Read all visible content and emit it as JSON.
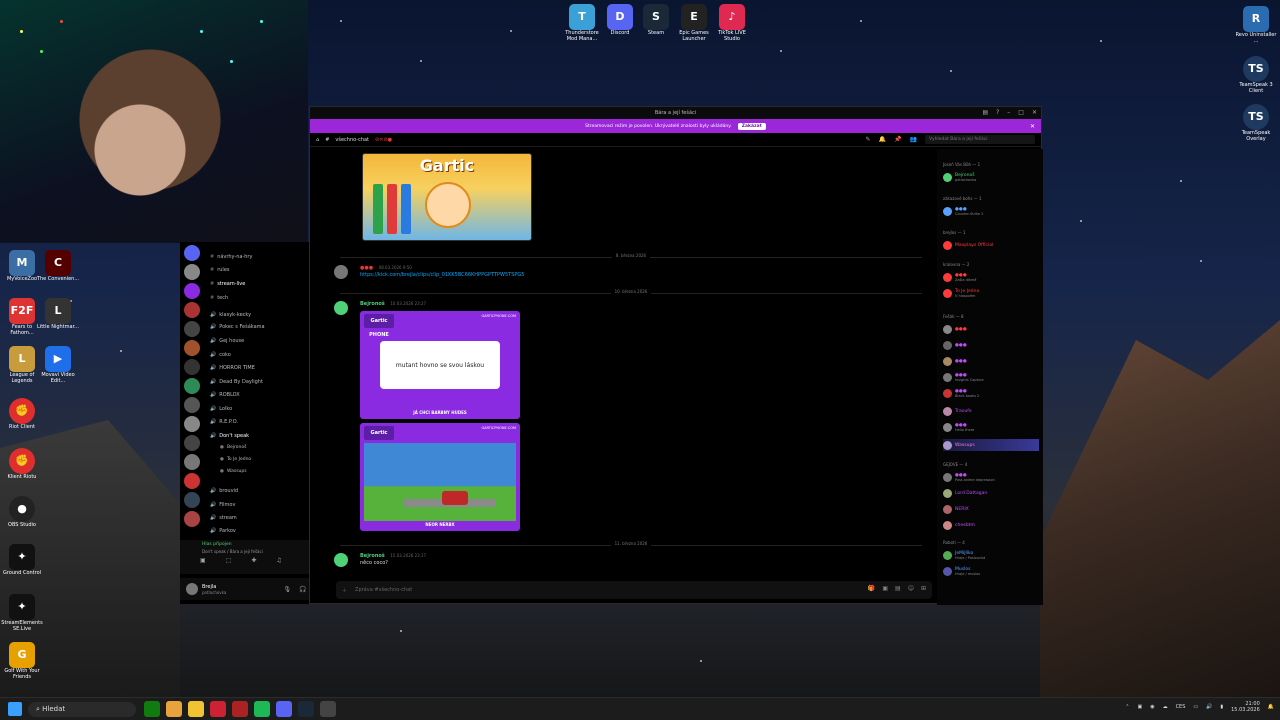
{
  "desktop": {
    "top_icons": [
      {
        "label": "Thunderstore Mod Mana...",
        "icon": "thunderstore-icon",
        "color": "#3aa0d6"
      },
      {
        "label": "Discord",
        "icon": "discord-icon",
        "color": "#5865f2"
      },
      {
        "label": "Steam",
        "icon": "steam-icon",
        "color": "#1b2838"
      },
      {
        "label": "Epic Games Launcher",
        "icon": "epic-icon",
        "color": "#222"
      },
      {
        "label": "TikTok LIVE Studio",
        "icon": "tiktok-icon",
        "color": "#e02950"
      }
    ],
    "right_icons": [
      {
        "label": "Revo Uninstaller ...",
        "icon": "revo-icon"
      },
      {
        "label": "TeamSpeak 3 Client",
        "icon": "teamspeak-icon"
      },
      {
        "label": "TeamSpeak Overlay",
        "icon": "teamspeak-overlay-icon"
      }
    ],
    "left_icons": [
      {
        "label": "MyVoiceZoo",
        "icon": "myvoicezoo-icon"
      },
      {
        "label": "The Convenien...",
        "icon": "convenience-icon"
      },
      {
        "label": "Fears to Fathom...",
        "icon": "f2f-icon"
      },
      {
        "label": "Little Nightmar...",
        "icon": "little-nightmares-icon"
      },
      {
        "label": "League of Legends",
        "icon": "lol-icon"
      },
      {
        "label": "Movavi Video Edit...",
        "icon": "movavi-icon"
      },
      {
        "label": "Riot Client",
        "icon": "riot-icon"
      },
      {
        "label": "Klient Riotu",
        "icon": "riot-client-icon"
      },
      {
        "label": "OBS Studio",
        "icon": "obs-icon"
      },
      {
        "label": "Ground Control",
        "icon": "ground-control-icon"
      },
      {
        "label": "StreamElements SE.Live",
        "icon": "streamelements-icon"
      },
      {
        "label": "Golf With Your Friends",
        "icon": "golf-icon"
      }
    ]
  },
  "window": {
    "title": "Bára a její fešáci",
    "banner_text": "Streamovací režim je povolen. Ukrývatelé znalosti byly ukládány.",
    "banner_button": "Zakázat",
    "channel_name": "všechno-chat",
    "search_placeholder": "Vyhledat Bára a její fešáci"
  },
  "chat": {
    "image_title": "Gartic",
    "day_separators": [
      "8. března 2026",
      "10. března 2026",
      "11. března 2026"
    ],
    "messages": [
      {
        "author": "●●●",
        "time": "08.03.2026 9:50",
        "link": "https://kick.com/brejla/clips/clip_01KK5BC66KHPPGPTTPW5TSPG5",
        "name_color": "#e33"
      },
      {
        "author": "Bejronoš",
        "time": "10.03.2026 23:27",
        "text": "",
        "name_color": "#4fd17a"
      },
      {
        "author": "Bejronoš",
        "time": "15.03.2026 23:17",
        "text": "něco coco?",
        "name_color": "#4fd17a"
      }
    ],
    "card1": {
      "logo": "Gartic PHONE",
      "site": "GARTICPHONE.COM",
      "bubble": "mutant hovno se svou láskou",
      "footer": "JÁ CHCI BARBNY HUDES"
    },
    "card2": {
      "logo": "Gartic PHONE",
      "site": "GARTICPHONE.COM",
      "footer": "NEOR NERBX"
    },
    "composer_placeholder": "Zpráva #všechno-chat"
  },
  "members": {
    "groups": [
      {
        "header": "Joseň Vás Bůh — 1",
        "items": [
          {
            "name": "Bejronoš",
            "color": "#4fd17a",
            "sub": "potlachovka"
          }
        ]
      },
      {
        "header": "zákazové bohs — 1",
        "items": [
          {
            "name": "●●●",
            "color": "#5aa0ff",
            "sub": "Counter-Strike 2"
          }
        ]
      },
      {
        "header": "brejlos — 1",
        "items": [
          {
            "name": "Maxplays Official",
            "color": "#ff3b3b",
            "sub": ""
          }
        ]
      },
      {
        "header": "kralovna — 2",
        "items": [
          {
            "name": "●●●",
            "color": "#ff3b3b",
            "sub": "Zašla dikmě"
          },
          {
            "name": "To Je Jedno",
            "color": "#ff3b3b",
            "sub": "V hlasovém"
          }
        ]
      },
      {
        "header": "Fešák — 8",
        "items": [
          {
            "name": "●●●",
            "color": "#ff3b3b",
            "sub": ""
          },
          {
            "name": "●●●",
            "color": "#c04ef5",
            "sub": ""
          },
          {
            "name": "●●●",
            "color": "#c04ef5",
            "sub": ""
          },
          {
            "name": "●●●",
            "color": "#c04ef5",
            "sub": "Insights Capture"
          },
          {
            "name": "●●●",
            "color": "#c04ef5",
            "sub": "Black books 2"
          },
          {
            "name": "Traoufe",
            "color": "#c04ef5",
            "sub": ""
          },
          {
            "name": "●●●",
            "color": "#c04ef5",
            "sub": "Hello there"
          },
          {
            "name": "Wassups",
            "color": "#ff7ad9",
            "sub": ""
          }
        ]
      },
      {
        "header": "GEJOVE — 4",
        "items": [
          {
            "name": "●●●",
            "color": "#c04ef5",
            "sub": "Post-anime depression"
          },
          {
            "name": "Lord Dattagan",
            "color": "#c04ef5",
            "sub": ""
          },
          {
            "name": "NERIX",
            "color": "#c04ef5",
            "sub": ""
          },
          {
            "name": "cheebtm",
            "color": "#c04ef5",
            "sub": ""
          }
        ]
      },
      {
        "header": "Roboti — 4",
        "items": [
          {
            "name": "JeMiJílko",
            "color": "#5aa0ff",
            "sub": "Hraje / Poslouchá"
          },
          {
            "name": "Muslos",
            "color": "#5aa0ff",
            "sub": "Hraje / muslos"
          }
        ]
      }
    ]
  },
  "sidebar": {
    "channels": [
      {
        "label": "návrhy-na-hry",
        "kind": "text"
      },
      {
        "label": "rules",
        "kind": "text"
      },
      {
        "label": "stream-live",
        "kind": "text"
      },
      {
        "label": "tech",
        "kind": "text"
      },
      {
        "label": "klasyk-kecky",
        "kind": "voice"
      },
      {
        "label": "Pokec s Fešákama",
        "kind": "voice"
      },
      {
        "label": "Gej house",
        "kind": "voice"
      },
      {
        "label": "coko",
        "kind": "voice"
      },
      {
        "label": "HORROR TIME",
        "kind": "voice"
      },
      {
        "label": "Dead By Daylight",
        "kind": "voice"
      },
      {
        "label": "ROBLOX",
        "kind": "voice"
      },
      {
        "label": "Lolko",
        "kind": "voice"
      },
      {
        "label": "R.E.P.O.",
        "kind": "voice"
      },
      {
        "label": "Don't speak",
        "kind": "voice"
      },
      {
        "label": "Bejronoš",
        "kind": "user"
      },
      {
        "label": "To Je Jedno",
        "kind": "user"
      },
      {
        "label": "Wassups",
        "kind": "user"
      },
      {
        "label": "brouvid",
        "kind": "voice"
      },
      {
        "label": "Filmov",
        "kind": "voice"
      },
      {
        "label": "stream",
        "kind": "voice"
      },
      {
        "label": "Parkov",
        "kind": "voice"
      }
    ],
    "voice_status": "Hlas připojen",
    "voice_channel": "Don't speak / Bára a její fešáci",
    "user_name": "Brejla",
    "user_status": "potlachovka"
  },
  "taskbar": {
    "search_label": "Hledat",
    "language": "CES",
    "time": "21:00",
    "date": "15.03.2026"
  }
}
